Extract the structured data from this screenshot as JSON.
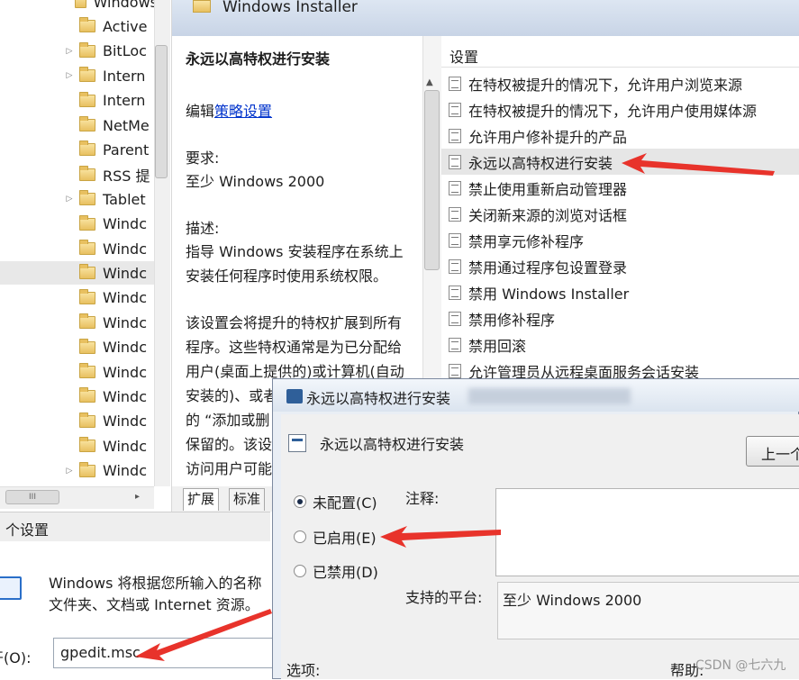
{
  "tree": {
    "items": [
      {
        "label": "Windows",
        "arrow": ""
      },
      {
        "label": "Active",
        "arrow": ""
      },
      {
        "label": "BitLoc",
        "arrow": "▷"
      },
      {
        "label": "Intern",
        "arrow": "▷"
      },
      {
        "label": "Intern",
        "arrow": ""
      },
      {
        "label": "NetMe",
        "arrow": ""
      },
      {
        "label": "Parent",
        "arrow": ""
      },
      {
        "label": "RSS 提",
        "arrow": ""
      },
      {
        "label": "Tablet",
        "arrow": "▷"
      },
      {
        "label": "Windc",
        "arrow": ""
      },
      {
        "label": "Windc",
        "arrow": ""
      },
      {
        "label": "Windc",
        "arrow": "",
        "selected": true
      },
      {
        "label": "Windc",
        "arrow": ""
      },
      {
        "label": "Windc",
        "arrow": ""
      },
      {
        "label": "Windc",
        "arrow": ""
      },
      {
        "label": "Windc",
        "arrow": ""
      },
      {
        "label": "Windc",
        "arrow": ""
      },
      {
        "label": "Windc",
        "arrow": ""
      },
      {
        "label": "Windc",
        "arrow": ""
      },
      {
        "label": "Windc",
        "arrow": "▷"
      }
    ],
    "hscroll_grip": "III"
  },
  "header": {
    "title": "Windows Installer"
  },
  "description": {
    "policy_title": "永远以高特权进行安装",
    "edit_prefix": "编辑",
    "edit_link": "策略设置",
    "req_label": "要求:",
    "req_value": "至少 Windows 2000",
    "desc_label": "描述:",
    "desc_lines": [
      "指导 Windows 安装程序在系统上",
      "安装任何程序时使用系统权限。"
    ],
    "body_lines": [
      "该设置会将提升的特权扩展到所有",
      "程序。这些特权通常是为已分配给",
      "用户(桌面上提供的)或计算机(自动",
      "安装的)、或者",
      "的 “添加或删",
      "保留的。该设",
      "访问用户可能"
    ]
  },
  "settings": {
    "header": "设置",
    "items": [
      "在特权被提升的情况下，允许用户浏览来源",
      "在特权被提升的情况下，允许用户使用媒体源",
      "允许用户修补提升的产品",
      "永远以高特权进行安装",
      "禁止使用重新启动管理器",
      "关闭新来源的浏览对话框",
      "禁用享元修补程序",
      "禁用通过程序包设置登录",
      "禁用 Windows Installer",
      "禁用修补程序",
      "禁用回滚",
      "允许管理员从远程桌面服务会话安装"
    ],
    "selected_index": 3
  },
  "tabs": {
    "extended": "扩展",
    "standard": "标准"
  },
  "status_bar": {
    "text": "个设置"
  },
  "run_dialog": {
    "line1": "Windows 将根据您所输入的名称",
    "line2": "文件夹、文档或 Internet 资源。",
    "open_label": "开(O):",
    "input_value": "gpedit.msc"
  },
  "policy_dialog": {
    "title": "永远以高特权进行安装",
    "name": "永远以高特权进行安装",
    "prev_button": "上一个",
    "radios": [
      {
        "label": "未配置(C)",
        "checked": true
      },
      {
        "label": "已启用(E)",
        "checked": false
      },
      {
        "label": "已禁用(D)",
        "checked": false
      }
    ],
    "comment_label": "注释:",
    "platform_label": "支持的平台:",
    "platform_value": "至少 Windows 2000",
    "options_label": "选项:",
    "help_label": "帮助:"
  },
  "watermark": "CSDN @七六九",
  "colors": {
    "link": "#0033cc",
    "annotation_arrow": "#e8332b",
    "selection": "#e6e6e6"
  }
}
